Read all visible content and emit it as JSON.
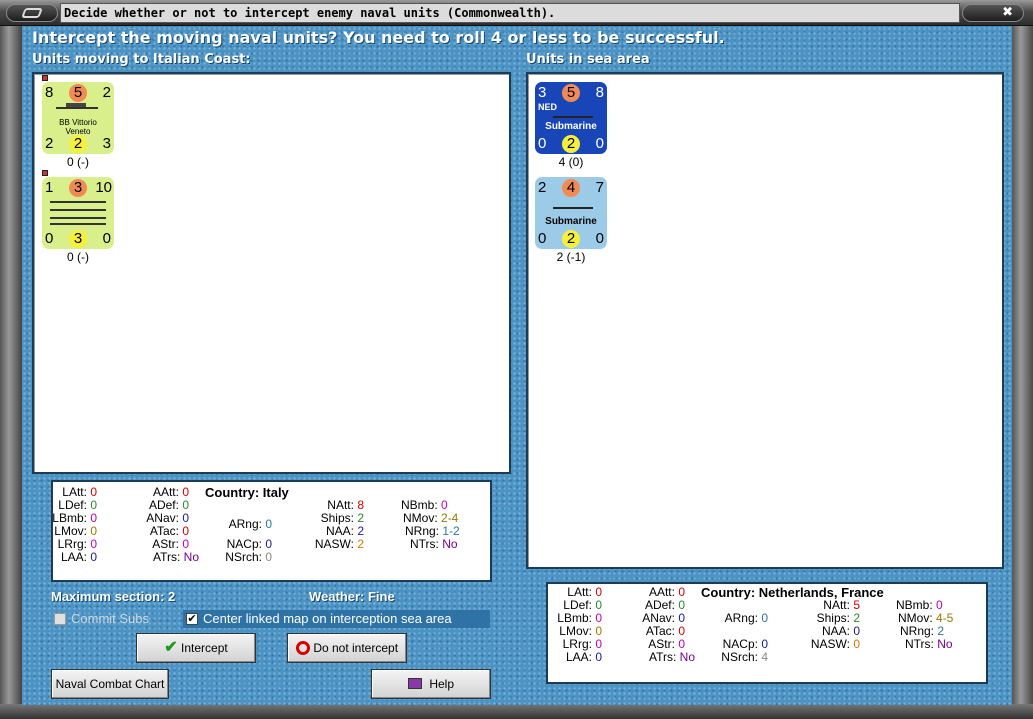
{
  "window": {
    "title": "Decide whether or not to intercept enemy naval units (Commonwealth).",
    "close_glyph": "✖"
  },
  "heading": "Intercept the moving naval units?  You need to roll 4 or less to be successful.",
  "left_section": {
    "label": "Units moving to Italian Coast:"
  },
  "right_section": {
    "label": "Units in sea area"
  },
  "moving_units": [
    {
      "name_line1": "BB Vittorio",
      "name_line2": "Veneto",
      "tl": "8",
      "tc": "5",
      "tr": "2",
      "bl": "2",
      "bc": "2",
      "br": "3",
      "below": "0 (-)",
      "color": "#d9ef8b"
    },
    {
      "name_line1": "",
      "name_line2": "",
      "tl": "1",
      "tc": "3",
      "tr": "10",
      "bl": "0",
      "bc": "3",
      "br": "0",
      "below": "0 (-)",
      "color": "#d9ef8b"
    }
  ],
  "sea_units": [
    {
      "nation": "NED",
      "name": "Submarine",
      "tl": "3",
      "tc": "5",
      "tr": "8",
      "bl": "0",
      "bc": "2",
      "br": "0",
      "below": "4 (0)",
      "color": "#1846b8"
    },
    {
      "nation": "",
      "name": "Submarine",
      "tl": "2",
      "tc": "4",
      "tr": "7",
      "bl": "0",
      "bc": "2",
      "br": "0",
      "below": "2 (-1)",
      "color": "#9ccbe8"
    }
  ],
  "left_stats": {
    "country_label": "Country: Italy",
    "LAtt": "0",
    "LDef": "0",
    "LBmb": "0",
    "LMov": "0",
    "LRrg": "0",
    "LAA": "0",
    "AAtt": "0",
    "ADef": "0",
    "ANav": "0",
    "ATac": "0",
    "AStr": "0",
    "ATrs": "No",
    "ARng": "0",
    "NACp": "0",
    "NSrch": "0",
    "NAtt": "8",
    "Ships": "2",
    "NAA": "2",
    "NASW": "2",
    "NBmb": "0",
    "NMov": "2-4",
    "NRng": "1-2",
    "NTrs": "No"
  },
  "right_stats": {
    "country_label": "Country: Netherlands, France",
    "LAtt": "0",
    "LDef": "0",
    "LBmb": "0",
    "LMov": "0",
    "LRrg": "0",
    "LAA": "0",
    "AAtt": "0",
    "ADef": "0",
    "ANav": "0",
    "ATac": "0",
    "AStr": "0",
    "ATrs": "No",
    "ARng": "0",
    "NACp": "0",
    "NSrch": "4",
    "NAtt": "5",
    "Ships": "2",
    "NAA": "0",
    "NASW": "0",
    "NBmb": "0",
    "NMov": "4-5",
    "NRng": "2",
    "NTrs": "No"
  },
  "colors": {
    "red": "#d40000",
    "green": "#2a8a2a",
    "magenta": "#c000c0",
    "olive": "#9a7a00",
    "blue": "#1a1aa0",
    "teal": "#2a7a9a",
    "orange": "#d07a00",
    "purple": "#7a0090",
    "gray": "#888888"
  },
  "max_section": "Maximum section: 2",
  "weather": "Weather:  Fine",
  "checkboxes": {
    "commit_subs": "Commit Subs",
    "center_map": "Center linked map on interception sea area",
    "center_check": "✔"
  },
  "buttons": {
    "intercept": "Intercept",
    "do_not_intercept": "Do not intercept",
    "naval_combat_chart": "Naval Combat Chart",
    "help": "Help"
  }
}
